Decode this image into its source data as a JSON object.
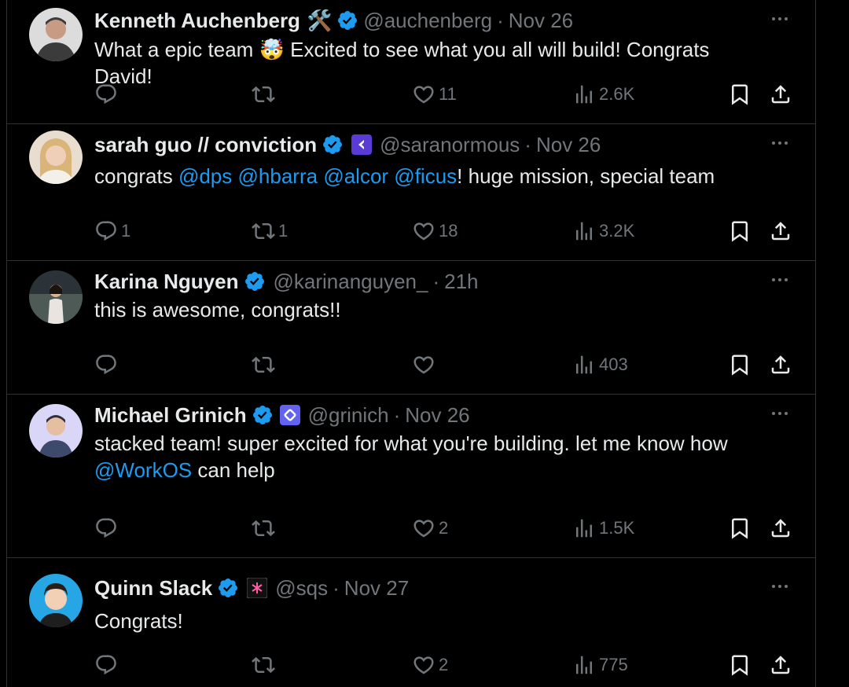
{
  "replies": [
    {
      "name": "Kenneth Auchenberg",
      "name_emoji": "🛠️",
      "handle": "@auchenberg",
      "sep": "·",
      "time": "Nov 26",
      "text": [
        "What a epic team ",
        "🤯",
        " Excited to see what you all will build! Congrats David!"
      ],
      "replies": "",
      "retweets": "",
      "likes": "11",
      "views": "2.6K",
      "avatar_bg": "#dcdcdc",
      "avatar_fg": "#3b3b3b"
    },
    {
      "name": "sarah guo // conviction",
      "handle": "@saranormous",
      "sep": "·",
      "time": "Nov 26",
      "text": [
        "congrats ",
        "@dps",
        " ",
        "@hbarra",
        " ",
        "@alcor",
        " ",
        "@ficus",
        "! huge mission, special team"
      ],
      "replies": "1",
      "retweets": "1",
      "likes": "18",
      "views": "3.2K",
      "avatar_bg": "#e9ddd0",
      "avatar_fg": "#d9b57a"
    },
    {
      "name": "Karina Nguyen",
      "handle": "@karinanguyen_",
      "sep": "·",
      "time": "21h",
      "text": [
        "this is awesome, congrats!!"
      ],
      "replies": "",
      "retweets": "",
      "likes": "",
      "views": "403",
      "avatar_bg": "#2b3338",
      "avatar_fg": "#e9e4df"
    },
    {
      "name": "Michael Grinich",
      "handle": "@grinich",
      "sep": "·",
      "time": "Nov 26",
      "text_line1": "stacked team! super excited for what you're building. let me know how",
      "text_mention": "@WorkOS",
      "text_rest": " can help",
      "replies": "",
      "retweets": "",
      "likes": "2",
      "views": "1.5K",
      "avatar_bg": "#d9d6f7",
      "avatar_fg": "#2f2f3a"
    },
    {
      "name": "Quinn Slack",
      "handle": "@sqs",
      "sep": "·",
      "time": "Nov 27",
      "text": [
        "Congrats!"
      ],
      "replies": "",
      "retweets": "",
      "likes": "2",
      "views": "775",
      "avatar_bg": "#27a6e5",
      "avatar_fg": "#2b1d14"
    }
  ],
  "colors": {
    "background": "#000000",
    "text": "#e7e9ea",
    "muted": "#71767b",
    "accent": "#1d9bf0",
    "divider": "#2f3336"
  },
  "icons": {
    "verified": "verified-badge-icon",
    "reply": "reply-icon",
    "retweet": "retweet-icon",
    "like": "heart-icon",
    "views": "views-icon",
    "bookmark": "bookmark-icon",
    "share": "share-icon",
    "more": "more-icon"
  }
}
